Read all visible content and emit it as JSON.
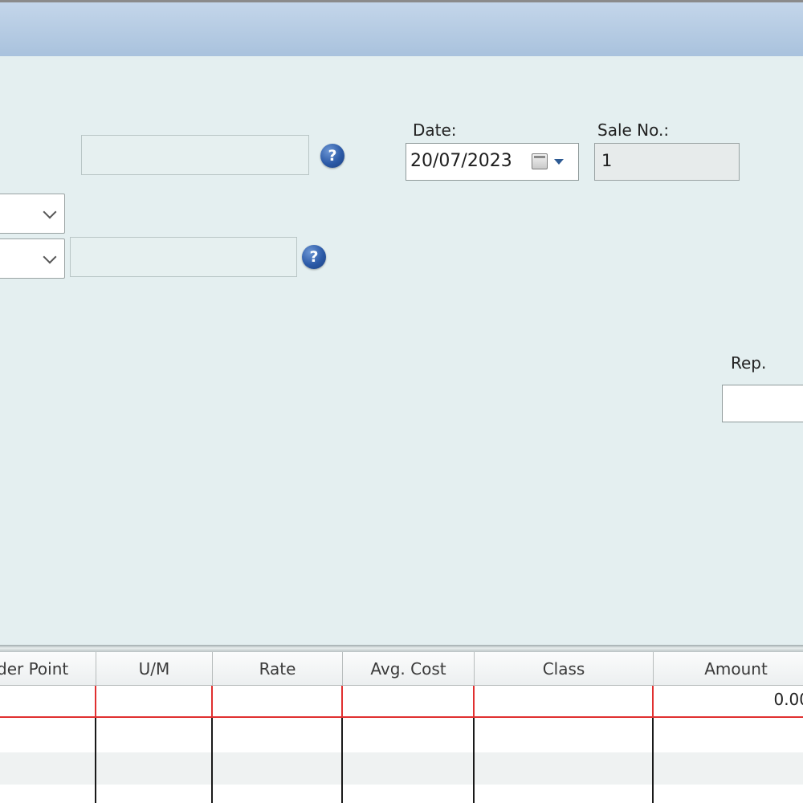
{
  "form": {
    "date_label": "Date:",
    "date_value": "20/07/2023",
    "sale_no_label": "Sale No.:",
    "sale_no_value": "1",
    "rep_label": "Rep.",
    "help_glyph": "?"
  },
  "grid": {
    "columns": [
      "der Point",
      "U/M",
      "Rate",
      "Avg. Cost",
      "Class",
      "Amount"
    ],
    "rows": [
      {
        "amount": "0.00"
      }
    ]
  },
  "icons": [
    "help-icon",
    "calendar-icon",
    "dropdown-arrow-icon",
    "chevron-down-icon"
  ],
  "colors": {
    "panel": "#e4eff0",
    "title_band": "#b3c9e1",
    "row_highlight": "#e03030",
    "help_icon": "#2c5aa7"
  }
}
